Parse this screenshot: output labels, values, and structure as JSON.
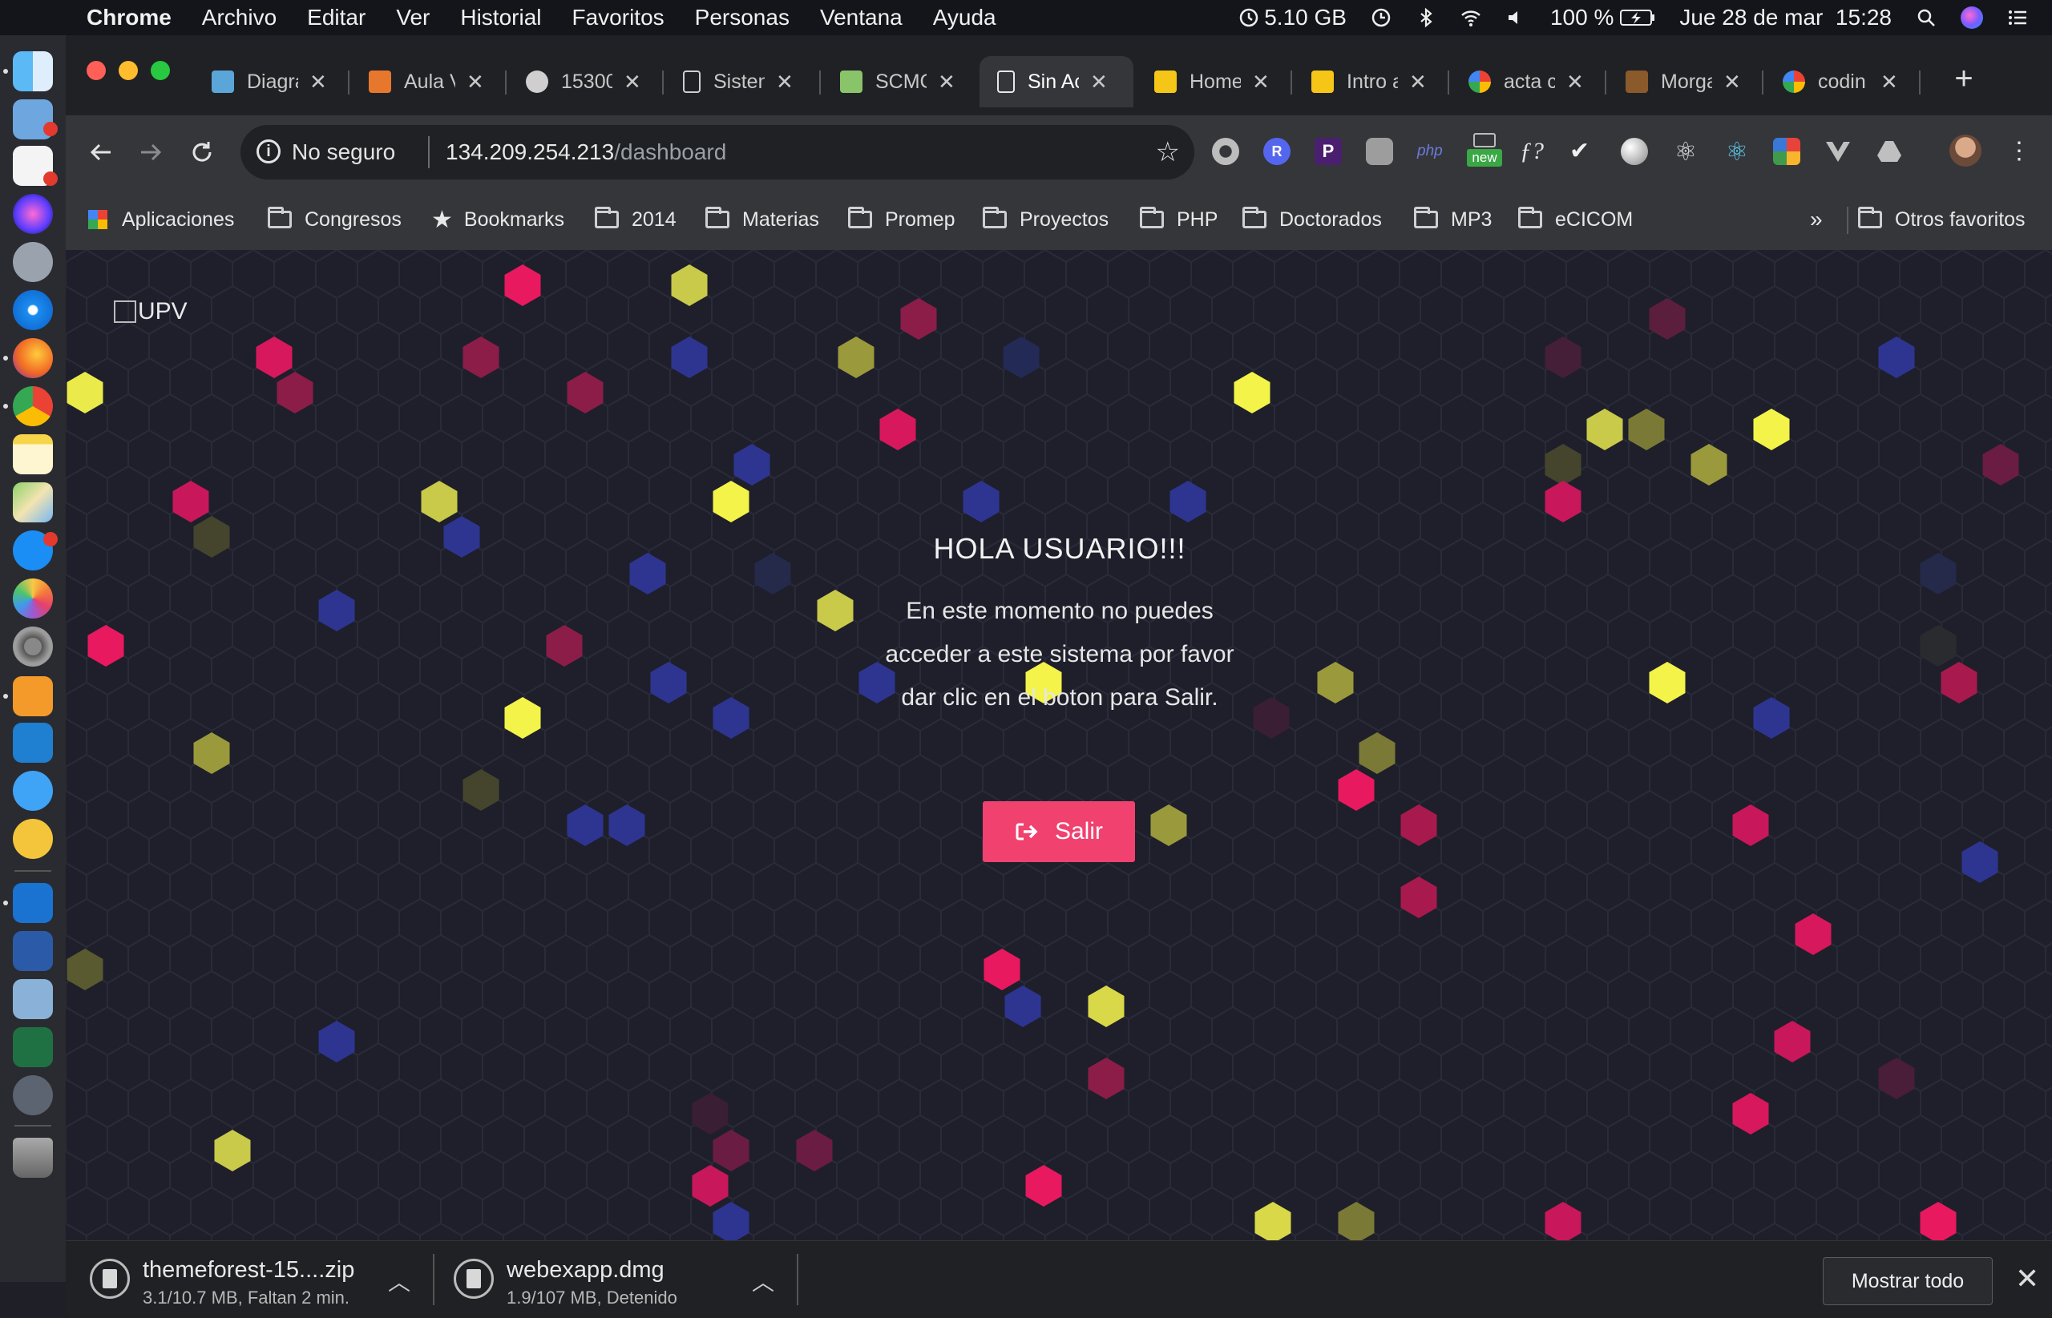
{
  "menubar": {
    "app": "Chrome",
    "items": [
      "Archivo",
      "Editar",
      "Ver",
      "Historial",
      "Favoritos",
      "Personas",
      "Ventana",
      "Ayuda"
    ],
    "memory": "5.10 GB",
    "battery": "100 %",
    "datetime": "Jue 28 de mar  15:28"
  },
  "tabs": [
    {
      "title": "Diagra",
      "favicon_color": "#5aa6d8"
    },
    {
      "title": "Aula V",
      "favicon_color": "#e8772e"
    },
    {
      "title": "15300",
      "favicon_color": "#cfcfcf"
    },
    {
      "title": "Sisten",
      "favicon_color": "#cfcfcf"
    },
    {
      "title": "SCMC",
      "favicon_color": "#8ac46a"
    },
    {
      "title": "Sin Ac",
      "favicon_color": "#cfcfcf",
      "active": true
    },
    {
      "title": "Home",
      "favicon_color": "#f5c518"
    },
    {
      "title": "Intro a",
      "favicon_color": "#f5c518"
    },
    {
      "title": "acta c",
      "favicon_color": "#4285f4"
    },
    {
      "title": "Morga",
      "favicon_color": "#8a5a2b"
    },
    {
      "title": "codin",
      "favicon_color": "#4285f4"
    }
  ],
  "omnibox": {
    "security_label": "No seguro",
    "host": "134.209.254.213",
    "path": "/dashboard"
  },
  "extensions": {
    "new_badge": "new",
    "php_label": "php",
    "p_label": "P",
    "r_label": "R"
  },
  "bookmarks": {
    "apps": "Aplicaciones",
    "items": [
      "Congresos",
      "Bookmarks",
      "2014",
      "Materias",
      "Promep",
      "Proyectos",
      "PHP",
      "Doctorados",
      "MP3",
      "eCICOM"
    ],
    "overflow": "»",
    "other": "Otros favoritos"
  },
  "page": {
    "logo_alt": "UPV",
    "greeting": "HOLA USUARIO!!!",
    "message": "En este momento no puedes acceder a este sistema por favor dar clic en el boton para Salir.",
    "button_label": "Salir",
    "colors": {
      "accent": "#f0416f",
      "background": "#1e1f2b"
    }
  },
  "downloads": {
    "items": [
      {
        "name": "themeforest-15....zip",
        "status": "3.1/10.7 MB, Faltan 2 min."
      },
      {
        "name": "webexapp.dmg",
        "status": "1.9/107 MB, Detenido"
      }
    ],
    "show_all": "Mostrar todo"
  }
}
